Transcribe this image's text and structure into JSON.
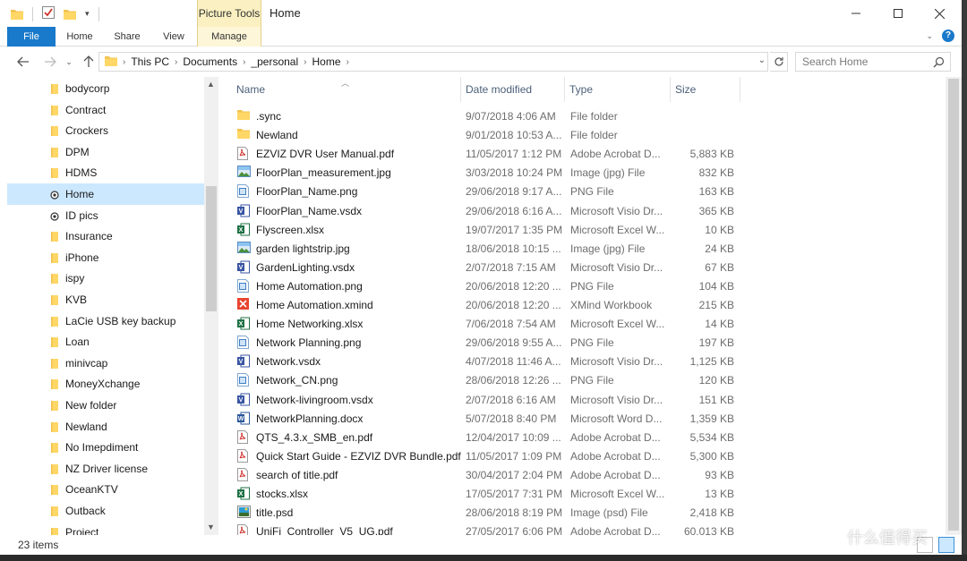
{
  "window": {
    "title": "Home",
    "contextual_tab_header": "Picture Tools"
  },
  "ribbon": {
    "tabs": [
      "File",
      "Home",
      "Share",
      "View",
      "Manage"
    ],
    "help": "?"
  },
  "address": {
    "crumbs": [
      "This PC",
      "Documents",
      "_personal",
      "Home"
    ]
  },
  "search": {
    "placeholder": "Search Home"
  },
  "nav": {
    "items": [
      {
        "label": "bodycorp",
        "icon": "folder-icon"
      },
      {
        "label": "Contract",
        "icon": "folder-icon"
      },
      {
        "label": "Crockers",
        "icon": "folder-icon"
      },
      {
        "label": "DPM",
        "icon": "folder-icon"
      },
      {
        "label": "HDMS",
        "icon": "folder-icon"
      },
      {
        "label": "Home",
        "icon": "sync-folder-icon",
        "selected": true
      },
      {
        "label": "ID pics",
        "icon": "sync-folder-icon"
      },
      {
        "label": "Insurance",
        "icon": "folder-icon"
      },
      {
        "label": "iPhone",
        "icon": "folder-icon"
      },
      {
        "label": "ispy",
        "icon": "folder-icon"
      },
      {
        "label": "KVB",
        "icon": "folder-icon"
      },
      {
        "label": "LaCie USB key backup",
        "icon": "folder-icon"
      },
      {
        "label": "Loan",
        "icon": "folder-icon"
      },
      {
        "label": "minivcap",
        "icon": "folder-icon"
      },
      {
        "label": "MoneyXchange",
        "icon": "folder-icon"
      },
      {
        "label": "New folder",
        "icon": "folder-icon"
      },
      {
        "label": "Newland",
        "icon": "folder-icon"
      },
      {
        "label": "No Imepdiment",
        "icon": "folder-icon"
      },
      {
        "label": "NZ Driver license",
        "icon": "folder-icon"
      },
      {
        "label": "OceanKTV",
        "icon": "folder-icon"
      },
      {
        "label": "Outback",
        "icon": "folder-icon"
      },
      {
        "label": "Project",
        "icon": "folder-icon"
      }
    ]
  },
  "columns": {
    "name": "Name",
    "date": "Date modified",
    "type": "Type",
    "size": "Size"
  },
  "files": [
    {
      "name": ".sync",
      "date": "9/07/2018 4:06 AM",
      "type": "File folder",
      "size": "",
      "icon": "folder"
    },
    {
      "name": "Newland",
      "date": "9/01/2018 10:53 A...",
      "type": "File folder",
      "size": "",
      "icon": "folder"
    },
    {
      "name": "EZVIZ DVR User Manual.pdf",
      "date": "11/05/2017 1:12 PM",
      "type": "Adobe Acrobat D...",
      "size": "5,883 KB",
      "icon": "pdf"
    },
    {
      "name": "FloorPlan_measurement.jpg",
      "date": "3/03/2018 10:24 PM",
      "type": "Image (jpg) File",
      "size": "832 KB",
      "icon": "image"
    },
    {
      "name": "FloorPlan_Name.png",
      "date": "29/06/2018 9:17 A...",
      "type": "PNG File",
      "size": "163 KB",
      "icon": "png"
    },
    {
      "name": "FloorPlan_Name.vsdx",
      "date": "29/06/2018 6:16 A...",
      "type": "Microsoft Visio Dr...",
      "size": "365 KB",
      "icon": "visio"
    },
    {
      "name": "Flyscreen.xlsx",
      "date": "19/07/2017 1:35 PM",
      "type": "Microsoft Excel W...",
      "size": "10 KB",
      "icon": "excel"
    },
    {
      "name": "garden lightstrip.jpg",
      "date": "18/06/2018 10:15 ...",
      "type": "Image (jpg) File",
      "size": "24 KB",
      "icon": "image"
    },
    {
      "name": "GardenLighting.vsdx",
      "date": "2/07/2018 7:15 AM",
      "type": "Microsoft Visio Dr...",
      "size": "67 KB",
      "icon": "visio"
    },
    {
      "name": "Home Automation.png",
      "date": "20/06/2018 12:20 ...",
      "type": "PNG File",
      "size": "104 KB",
      "icon": "png"
    },
    {
      "name": "Home Automation.xmind",
      "date": "20/06/2018 12:20 ...",
      "type": "XMind Workbook",
      "size": "215 KB",
      "icon": "xmind"
    },
    {
      "name": "Home Networking.xlsx",
      "date": "7/06/2018 7:54 AM",
      "type": "Microsoft Excel W...",
      "size": "14 KB",
      "icon": "excel"
    },
    {
      "name": "Network Planning.png",
      "date": "29/06/2018 9:55 A...",
      "type": "PNG File",
      "size": "197 KB",
      "icon": "png"
    },
    {
      "name": "Network.vsdx",
      "date": "4/07/2018 11:46 A...",
      "type": "Microsoft Visio Dr...",
      "size": "1,125 KB",
      "icon": "visio"
    },
    {
      "name": "Network_CN.png",
      "date": "28/06/2018 12:26 ...",
      "type": "PNG File",
      "size": "120 KB",
      "icon": "png"
    },
    {
      "name": "Network-livingroom.vsdx",
      "date": "2/07/2018 6:16 AM",
      "type": "Microsoft Visio Dr...",
      "size": "151 KB",
      "icon": "visio"
    },
    {
      "name": "NetworkPlanning.docx",
      "date": "5/07/2018 8:40 PM",
      "type": "Microsoft Word D...",
      "size": "1,359 KB",
      "icon": "word"
    },
    {
      "name": "QTS_4.3.x_SMB_en.pdf",
      "date": "12/04/2017 10:09 ...",
      "type": "Adobe Acrobat D...",
      "size": "5,534 KB",
      "icon": "pdf"
    },
    {
      "name": "Quick Start Guide - EZVIZ DVR Bundle.pdf",
      "date": "11/05/2017 1:09 PM",
      "type": "Adobe Acrobat D...",
      "size": "5,300 KB",
      "icon": "pdf"
    },
    {
      "name": "search of title.pdf",
      "date": "30/04/2017 2:04 PM",
      "type": "Adobe Acrobat D...",
      "size": "93 KB",
      "icon": "pdf"
    },
    {
      "name": "stocks.xlsx",
      "date": "17/05/2017 7:31 PM",
      "type": "Microsoft Excel W...",
      "size": "13 KB",
      "icon": "excel"
    },
    {
      "name": "title.psd",
      "date": "28/06/2018 8:19 PM",
      "type": "Image (psd) File",
      "size": "2,418 KB",
      "icon": "psd"
    },
    {
      "name": "UniFi_Controller_V5_UG.pdf",
      "date": "27/05/2017 6:06 PM",
      "type": "Adobe Acrobat D...",
      "size": "60,013 KB",
      "icon": "pdf"
    }
  ],
  "status": {
    "item_count": "23 items"
  },
  "watermark": "什么值得买",
  "colors": {
    "file_tab": "#1979ca",
    "selection": "#cce8ff",
    "contextual": "#fbf0c1",
    "header_text": "#4c607a"
  }
}
